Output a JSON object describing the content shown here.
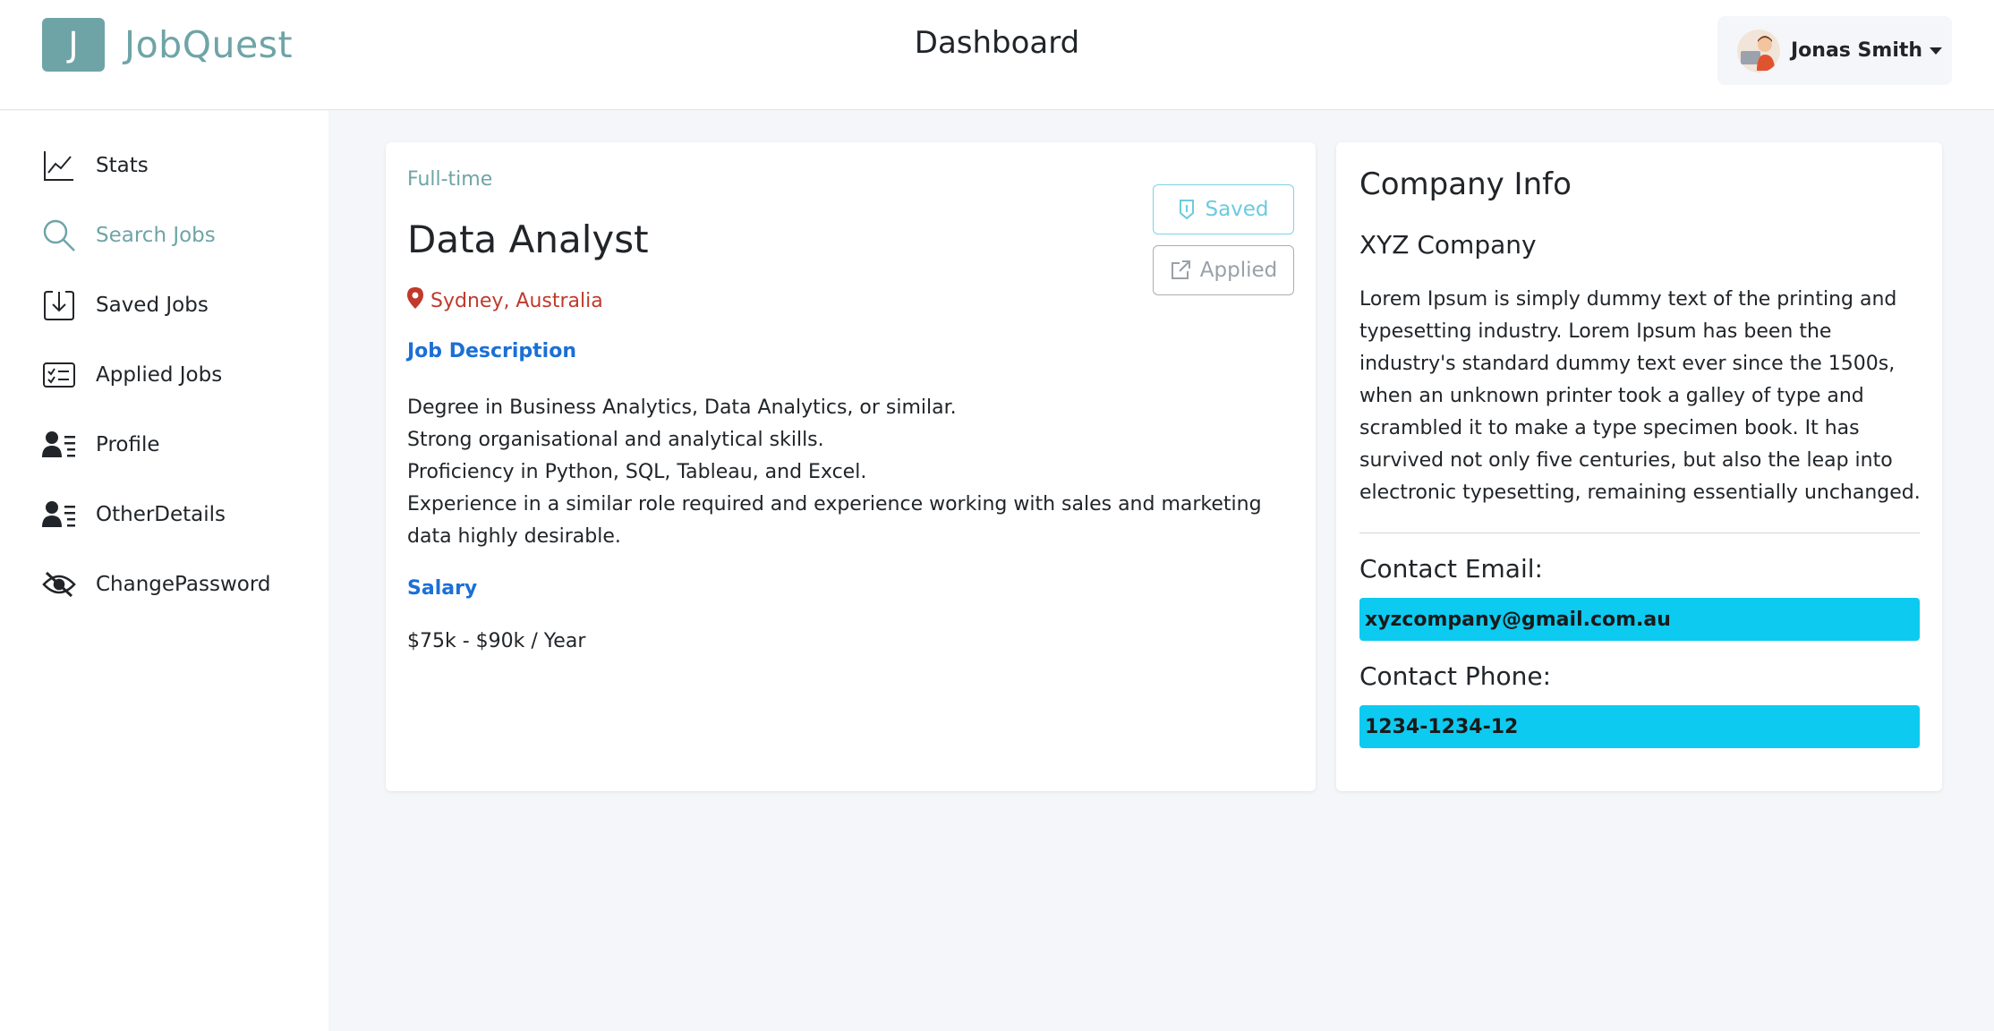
{
  "brand": {
    "letter": "J",
    "name": "JobQuest",
    "color": "#6fa4a7"
  },
  "header": {
    "title": "Dashboard",
    "user_name": "Jonas Smith"
  },
  "sidebar": {
    "items": [
      {
        "label": "Stats",
        "icon": "chart-line-icon",
        "active": false
      },
      {
        "label": "Search Jobs",
        "icon": "search-icon",
        "active": true
      },
      {
        "label": "Saved Jobs",
        "icon": "save-download-icon",
        "active": false
      },
      {
        "label": "Applied Jobs",
        "icon": "checklist-card-icon",
        "active": false
      },
      {
        "label": "Profile",
        "icon": "person-lines-icon",
        "active": false
      },
      {
        "label": "OtherDetails",
        "icon": "person-lines-icon",
        "active": false
      },
      {
        "label": "ChangePassword",
        "icon": "eye-slash-icon",
        "active": false
      }
    ]
  },
  "job": {
    "type": "Full-time",
    "title": "Data Analyst",
    "location": "Sydney, Australia",
    "description_heading": "Job Description",
    "description_lines": [
      "Degree in Business Analytics, Data Analytics, or similar.",
      "Strong organisational and analytical skills.",
      "Proficiency in Python, SQL, Tableau, and Excel.",
      "Experience in a similar role required and experience working with sales and marketing data highly desirable."
    ],
    "salary_heading": "Salary",
    "salary": "$75k - $90k / Year",
    "saved_label": "Saved",
    "applied_label": "Applied"
  },
  "company": {
    "heading": "Company Info",
    "name": "XYZ Company",
    "description": "Lorem Ipsum is simply dummy text of the printing and typesetting industry. Lorem Ipsum has been the industry's standard dummy text ever since the 1500s, when an unknown printer took a galley of type and scrambled it to make a type specimen book. It has survived not only five centuries, but also the leap into electronic typesetting, remaining essentially unchanged.",
    "email_label": "Contact Email:",
    "email": "xyzcompany@gmail.com.au",
    "phone_label": "Contact Phone:",
    "phone": "1234-1234-12"
  },
  "colors": {
    "accent": "#6fa4a7",
    "link_blue": "#1c6fd6",
    "location_red": "#c0392b",
    "cyan": "#0dcaf0"
  }
}
